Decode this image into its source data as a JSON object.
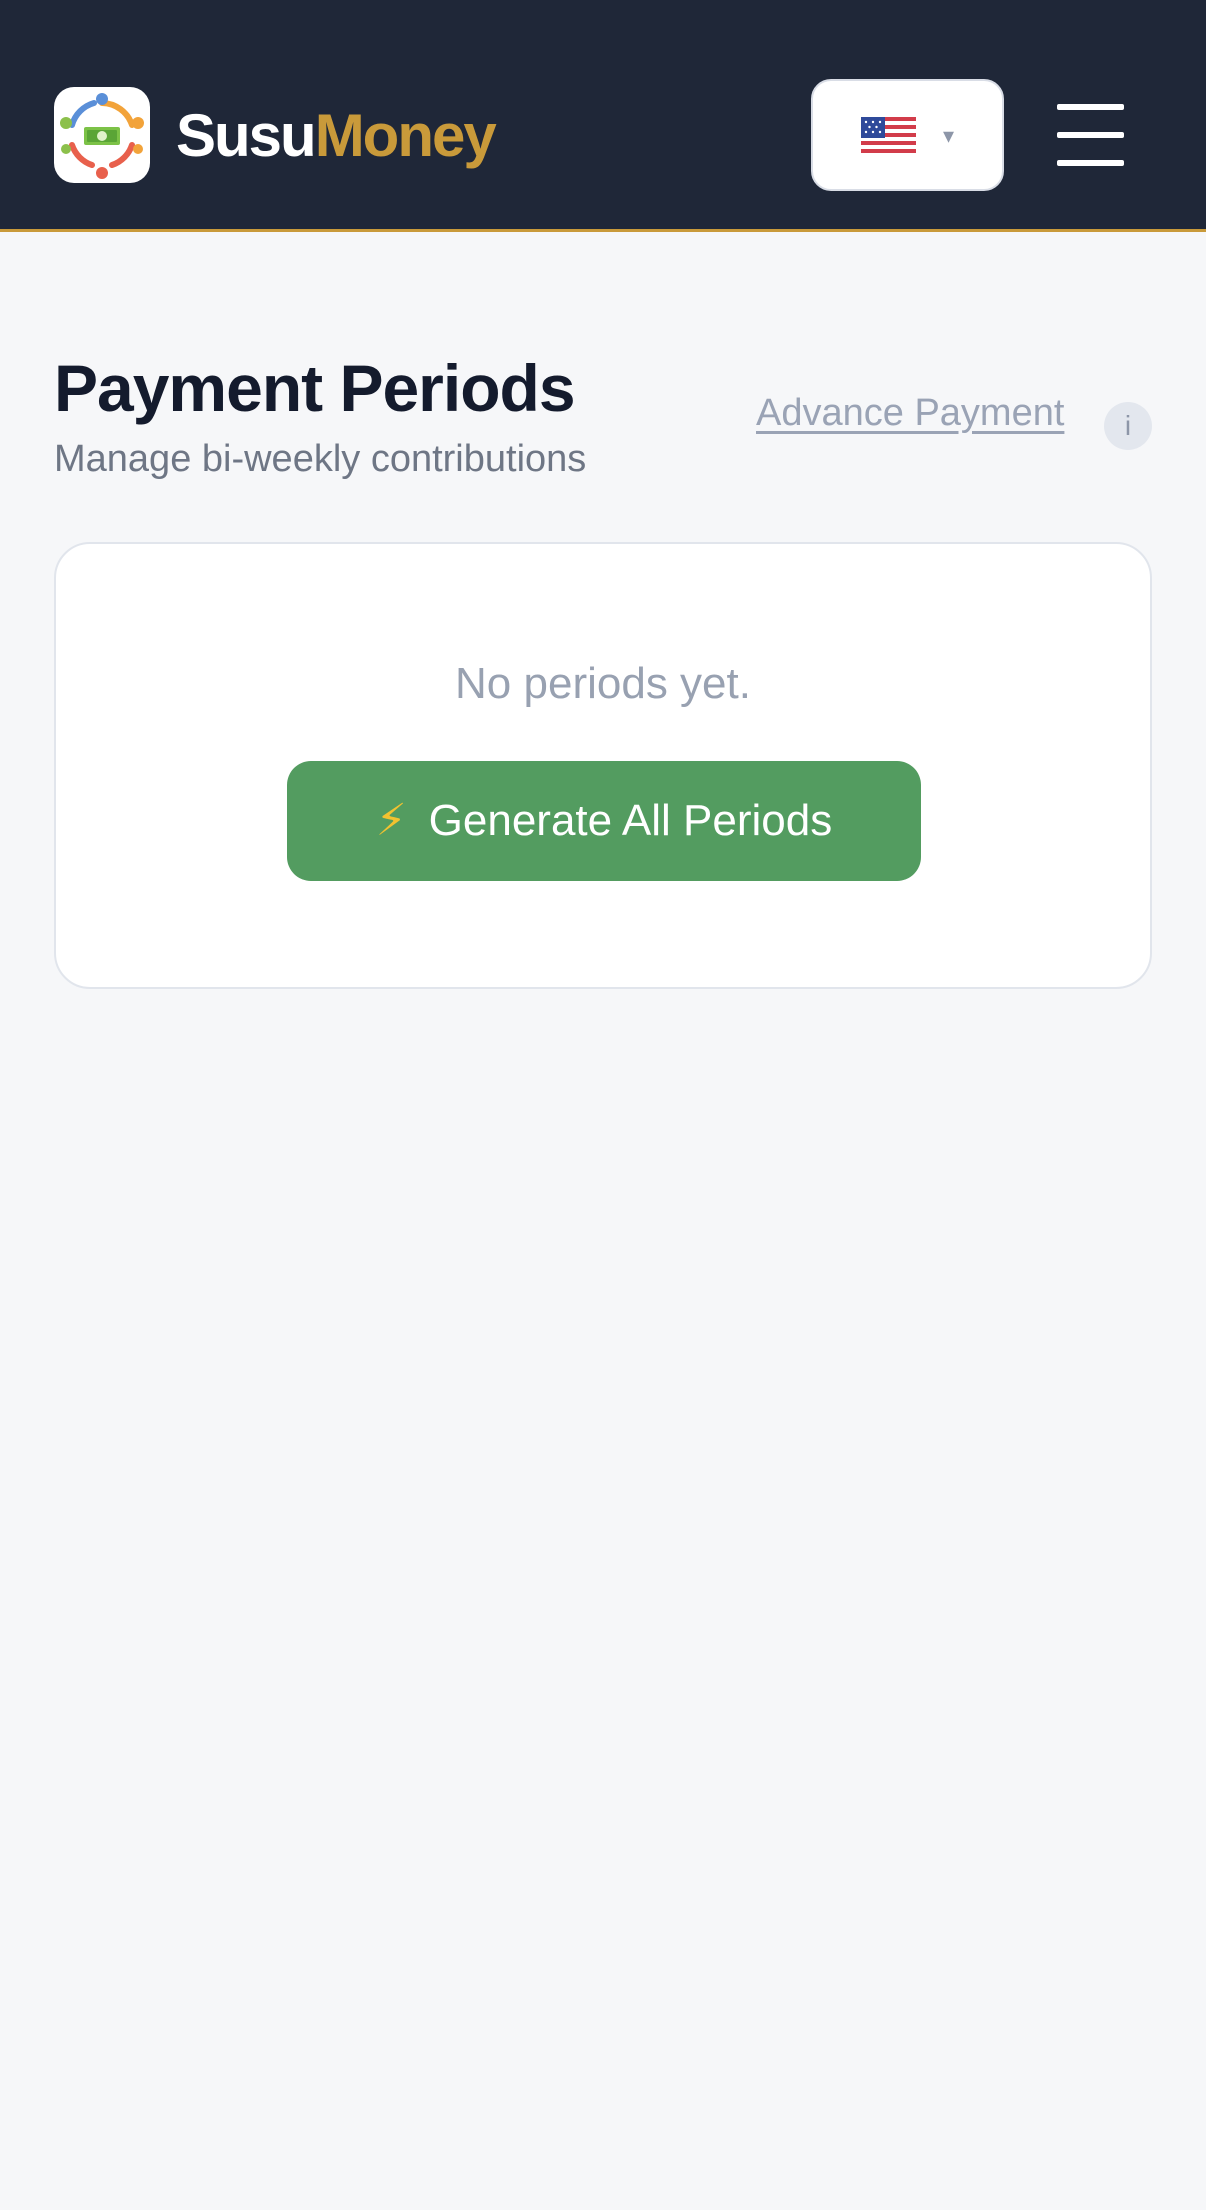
{
  "header": {
    "brand_part1": "Susu",
    "brand_part2": "Money",
    "language": {
      "flag_icon": "us-flag-icon",
      "caret": "▾"
    },
    "menu_icon": "hamburger-menu-icon"
  },
  "page": {
    "title": "Payment Periods",
    "subtitle": "Manage bi-weekly contributions",
    "advance_link": "Advance Payment",
    "info_icon": "i"
  },
  "periods_card": {
    "empty_message": "No periods yet.",
    "generate_button_icon": "⚡",
    "generate_button_label": "Generate All Periods"
  },
  "colors": {
    "header_bg": "#1f2738",
    "brand_accent": "#c99a3a",
    "primary_green": "#539c60",
    "page_bg": "#f6f7f9"
  }
}
